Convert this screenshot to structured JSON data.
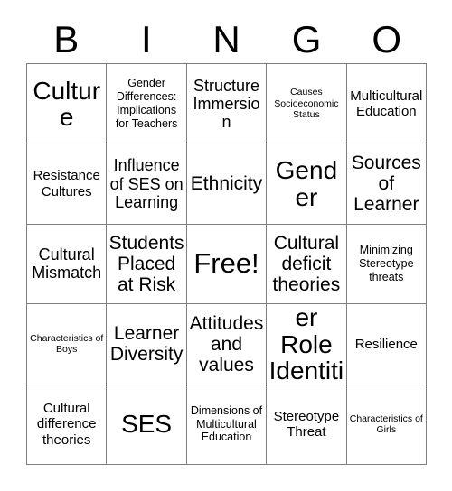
{
  "card": {
    "title_letters": [
      "B",
      "I",
      "N",
      "G",
      "O"
    ],
    "rows": 5,
    "columns": 5,
    "border_color": "#7f7f7f",
    "text_color": "#000000",
    "background_color": "#ffffff",
    "cells": [
      [
        {
          "text": "Culture",
          "size": "sz-xxl"
        },
        {
          "text": "Gender Differences: Implications for Teachers",
          "size": "sz-s"
        },
        {
          "text": "Structure Immersion",
          "size": "sz-l"
        },
        {
          "text": "Causes Socioeconomic Status",
          "size": "sz-xs"
        },
        {
          "text": "Multicultural Education",
          "size": "sz-m"
        }
      ],
      [
        {
          "text": "Resistance Cultures",
          "size": "sz-m"
        },
        {
          "text": "Influence of SES on Learning",
          "size": "sz-l"
        },
        {
          "text": "Ethnicity",
          "size": "sz-xl"
        },
        {
          "text": "Gender",
          "size": "sz-xxl"
        },
        {
          "text": "Sources of Learner",
          "size": "sz-xl"
        }
      ],
      [
        {
          "text": "Cultural Mismatch",
          "size": "sz-l"
        },
        {
          "text": "Students Placed at Risk",
          "size": "sz-xl"
        },
        {
          "text": "Free!",
          "size": "sz-free"
        },
        {
          "text": "Cultural deficit theories",
          "size": "sz-xl"
        },
        {
          "text": "Minimizing Stereotype threats",
          "size": "sz-s"
        }
      ],
      [
        {
          "text": "Characteristics of Boys",
          "size": "sz-xs"
        },
        {
          "text": "Learner Diversity",
          "size": "sz-xl"
        },
        {
          "text": "Attitudes and values",
          "size": "sz-xl"
        },
        {
          "text": "Gender Role Identitiy",
          "size": "sz-xxl"
        },
        {
          "text": "Resilience",
          "size": "sz-m"
        }
      ],
      [
        {
          "text": "Cultural difference theories",
          "size": "sz-m"
        },
        {
          "text": "SES",
          "size": "sz-xxl"
        },
        {
          "text": "Dimensions of Multicultural Education",
          "size": "sz-s"
        },
        {
          "text": "Stereotype Threat",
          "size": "sz-m"
        },
        {
          "text": "Characteristics of Girls",
          "size": "sz-xs"
        }
      ]
    ]
  }
}
